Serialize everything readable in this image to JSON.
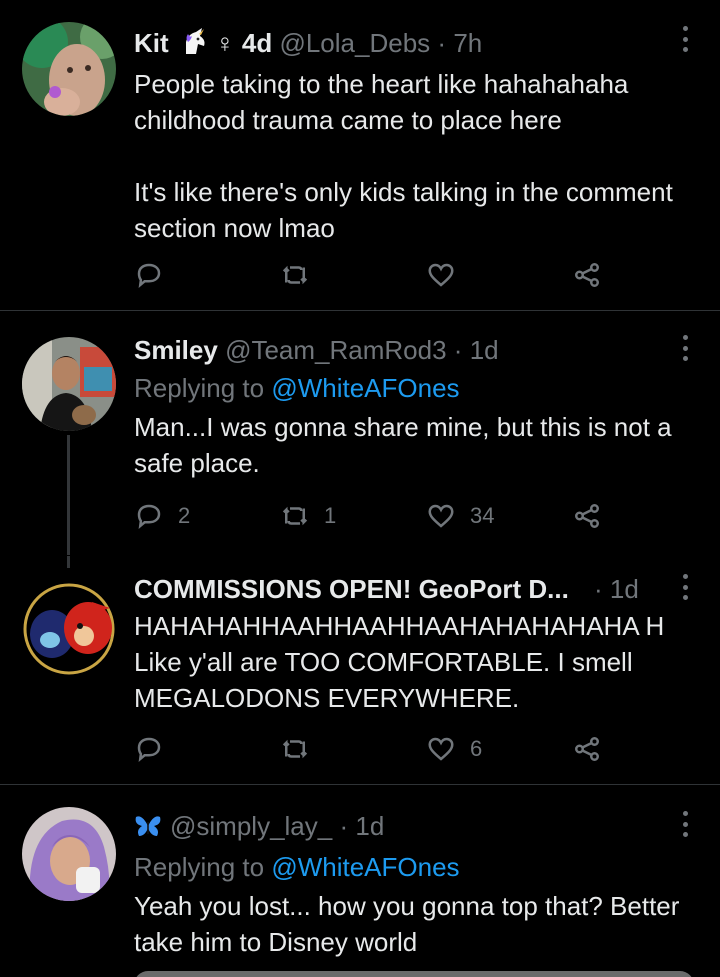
{
  "tweets": [
    {
      "name": "Kit",
      "badges": "♀ 4d",
      "handle": "@Lola_Debs",
      "time": "7h",
      "body": "People taking to the heart like hahahahaha childhood trauma came to place here\n\nIt's like there's only kids talking in the comment section now lmao",
      "reply_count": "",
      "retweet_count": "",
      "like_count": ""
    },
    {
      "name": "Smiley",
      "handle": "@Team_RamRod3",
      "time": "1d",
      "replying_prefix": "Replying to",
      "replying_to": "@WhiteAFOnes",
      "body": "Man...I was gonna share mine, but this is not a safe place.",
      "reply_count": "2",
      "retweet_count": "1",
      "like_count": "34"
    },
    {
      "name": "COMMISSIONS OPEN! GeoPort D...",
      "time": "1d",
      "body": "HAHAHAHHAAHHAAHHAAHAHAHAHAHA H Like y'all are TOO COMFORTABLE. I smell MEGALODONS EVERYWHERE.",
      "reply_count": "",
      "retweet_count": "",
      "like_count": "6"
    },
    {
      "handle": "@simply_lay_",
      "time": "1d",
      "replying_prefix": "Replying to",
      "replying_to": "@WhiteAFOnes",
      "body": "Yeah you lost... how you gonna top that? Better take him to Disney world"
    }
  ],
  "separator": "·",
  "colors": {
    "background": "#000000",
    "text": "#e7e9ea",
    "muted": "#71767b",
    "link": "#1d9bf0",
    "divider": "#2f3336"
  },
  "icons": [
    "reply-icon",
    "retweet-icon",
    "like-icon",
    "share-icon",
    "more-icon",
    "unicorn-emoji",
    "butterfly-emoji"
  ]
}
